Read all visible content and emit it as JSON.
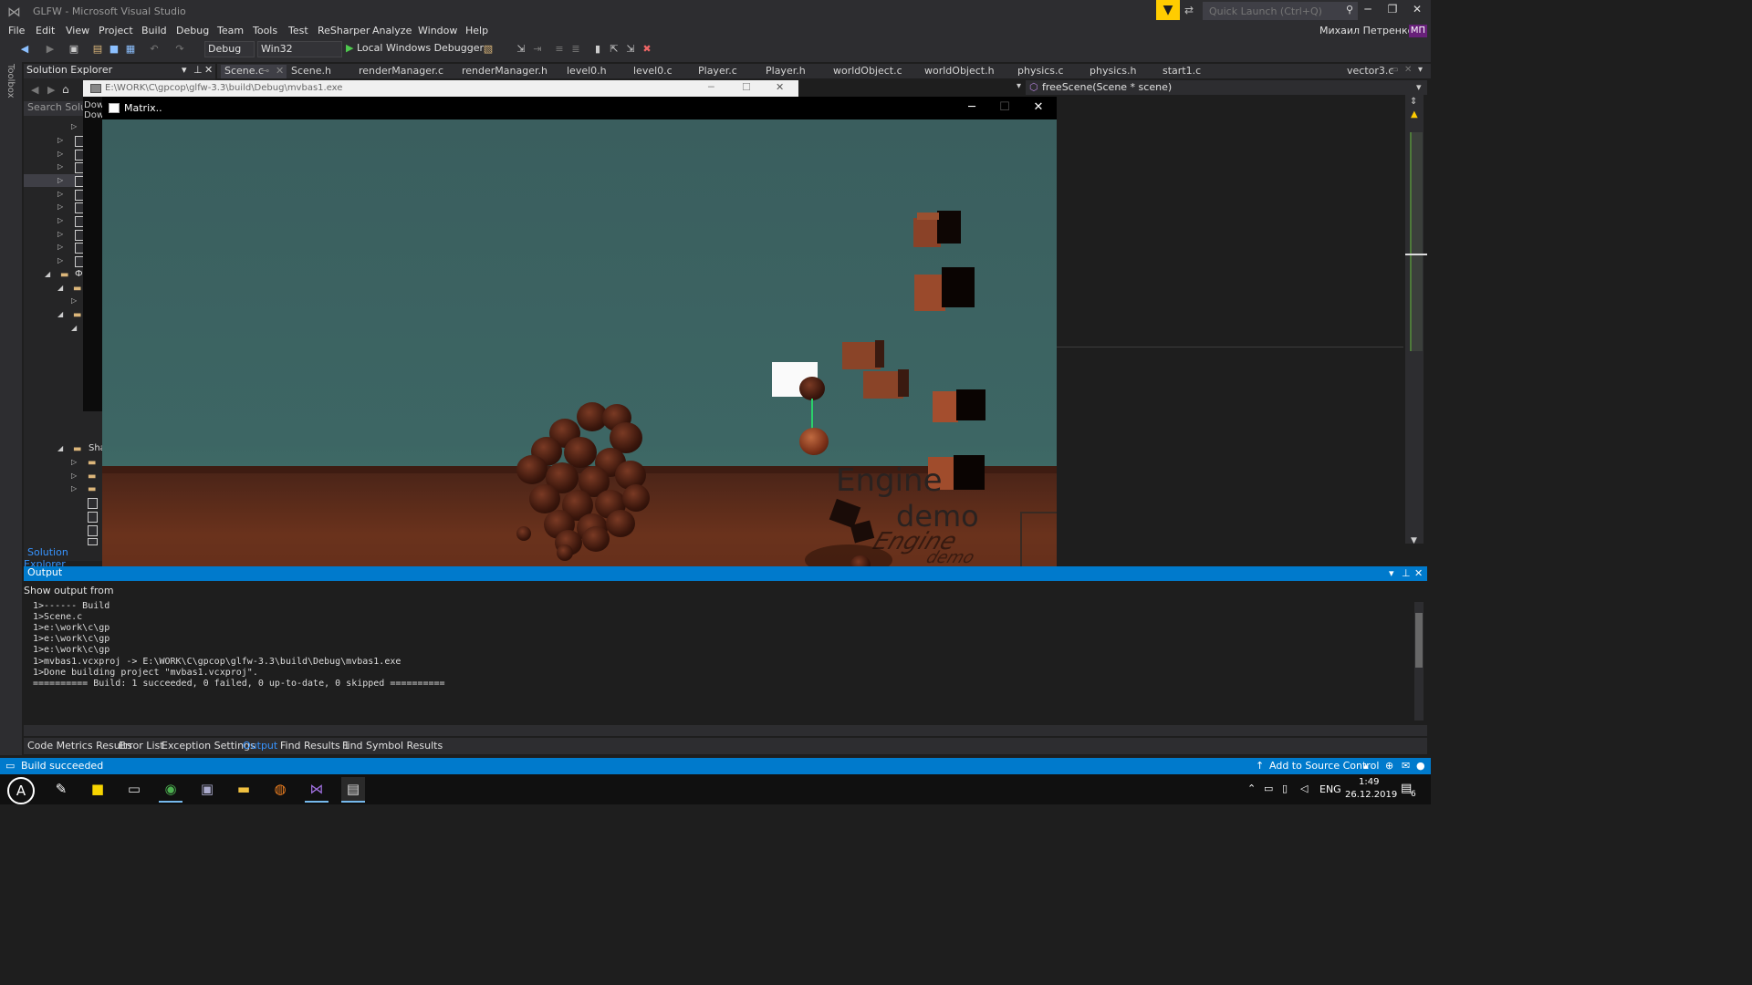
{
  "window": {
    "title": "GLFW - Microsoft Visual Studio",
    "quick_launch_placeholder": "Quick Launch (Ctrl+Q)",
    "user_name": "Михаил Петренко",
    "user_initials": "МП",
    "minimize": "─",
    "restore": "❐",
    "close": "✕"
  },
  "menu": [
    "File",
    "Edit",
    "View",
    "Project",
    "Build",
    "Debug",
    "Team",
    "Tools",
    "Test",
    "ReSharper",
    "Analyze",
    "Window",
    "Help"
  ],
  "toolbar": {
    "config": "Debug",
    "platform": "Win32",
    "run_label": "Local Windows Debugger"
  },
  "toolbox_label": "Toolbox",
  "solution_explorer": {
    "title": "Solution Explorer",
    "search_placeholder": "Search Solutio",
    "footer_tab": "Solution Explorer",
    "folder_label_1": "Ф",
    "folder_label_2": "Sha"
  },
  "doc_tabs": [
    "Scene.c",
    "Scene.h",
    "renderManager.c",
    "renderManager.h",
    "level0.h",
    "level0.c",
    "Player.c",
    "Player.h",
    "worldObject.c",
    "worldObject.h",
    "physics.c",
    "physics.h",
    "start1.c",
    "vector3.c"
  ],
  "nav_bar": "freeScene(Scene * scene)",
  "console": {
    "title": "E:\\WORK\\C\\gpcop\\glfw-3.3\\build\\Debug\\mvbas1.exe",
    "line1": "Dow",
    "line2": "Dow"
  },
  "game": {
    "title": "Matrix..",
    "engine_text_1": "Engine",
    "engine_text_2": "demo",
    "engine_reflection_1": "Engine",
    "engine_reflection_2": "demo"
  },
  "output": {
    "title": "Output",
    "show_from": "Show output from",
    "lines": [
      "1>------ Build",
      "1>Scene.c",
      "1>e:\\work\\c\\gp",
      "1>e:\\work\\c\\gp",
      "1>e:\\work\\c\\gp",
      "1>mvbas1.vcxproj -> E:\\WORK\\C\\gpcop\\glfw-3.3\\build\\Debug\\mvbas1.exe",
      "1>Done building project \"mvbas1.vcxproj\".",
      "========== Build: 1 succeeded, 0 failed, 0 up-to-date, 0 skipped =========="
    ]
  },
  "bottom_tabs": [
    "Code Metrics Results",
    "Error List",
    "Exception Settings",
    "Output",
    "Find Results 1",
    "Find Symbol Results"
  ],
  "status": {
    "text": "Build succeeded",
    "source_control": "Add to Source Control"
  },
  "taskbar": {
    "lang": "ENG",
    "time": "1:49",
    "date": "26.12.2019",
    "notifications": "6"
  }
}
